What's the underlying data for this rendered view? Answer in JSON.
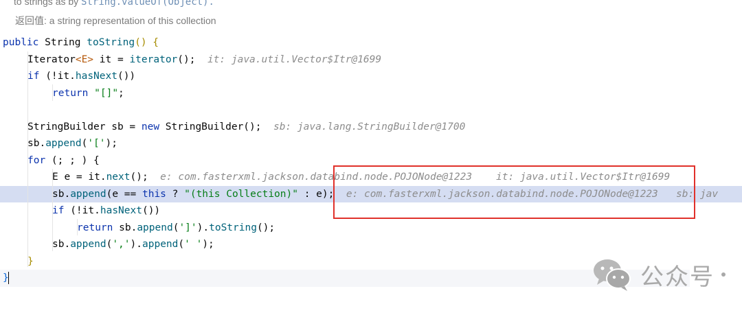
{
  "doc": {
    "line1_prefix": "to strings as by ",
    "line1_code": "String.valueOf(Object).",
    "return_label": "返回值: a string representation of this collection"
  },
  "code": {
    "l1": {
      "mod": "public",
      "type": "String",
      "name": "toString",
      "open": "() {"
    },
    "l2": {
      "a": "Iterator",
      "b": "<E>",
      "c": " it = ",
      "d": "iterator",
      "e": "();",
      "hint": "it: java.util.Vector$Itr@1699"
    },
    "l3": {
      "kw": "if",
      "rest": " (!it.",
      "fn": "hasNext",
      "end": "())"
    },
    "l4": {
      "kw": "return",
      "str": "\"[]\"",
      "end": ";"
    },
    "l6": {
      "a": "StringBuilder sb = ",
      "kw": "new",
      "b": " StringBuilder",
      "c": "();",
      "hint": "sb: java.lang.StringBuilder@1700"
    },
    "l7": {
      "a": "sb.",
      "fn": "append",
      "b": "(",
      "str": "'['",
      "c": ");"
    },
    "l8": {
      "kw": "for",
      "rest": " (; ; ) {"
    },
    "l9": {
      "a": "E e = it.",
      "fn": "next",
      "b": "();",
      "hint": "e: com.fasterxml.jackson.databind.node.POJONode@1223",
      "hint2": "it: java.util.Vector$Itr@1699"
    },
    "l10": {
      "a": "sb.",
      "fn": "append",
      "b": "(e == ",
      "kw": "this",
      "c": " ? ",
      "str": "\"(this Collection)\"",
      "d": " : e);",
      "hint": "e: com.fasterxml.jackson.databind.node.POJONode@1223",
      "hint2": "sb: jav"
    },
    "l11": {
      "kw": "if",
      "rest": " (!it.",
      "fn": "hasNext",
      "end": "())"
    },
    "l12": {
      "kw": "return",
      "a": " sb.",
      "fn": "append",
      "b": "(",
      "str": "']'",
      "c": ").",
      "fn2": "toString",
      "d": "();"
    },
    "l13": {
      "a": "sb.",
      "fn": "append",
      "b": "(",
      "str": "','",
      "c": ").",
      "fn2": "append",
      "d": "(",
      "str2": "' '",
      "e": ");"
    },
    "l14": {
      "brace": "}"
    },
    "l15": {
      "brace": "}"
    }
  },
  "watermark": {
    "text": "公众号",
    "icon": "wechat-icon"
  }
}
